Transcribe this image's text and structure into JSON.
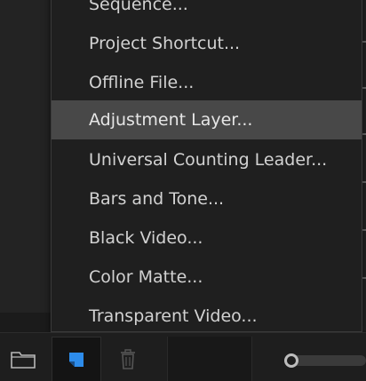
{
  "menu": {
    "items": [
      {
        "label": "Sequence...",
        "highlighted": false
      },
      {
        "label": "Project Shortcut...",
        "highlighted": false
      },
      {
        "label": "Offline File...",
        "highlighted": false
      },
      {
        "label": "Adjustment Layer...",
        "highlighted": true
      },
      {
        "label": "Universal Counting Leader...",
        "highlighted": false
      },
      {
        "label": "Bars and Tone...",
        "highlighted": false
      },
      {
        "label": "Black Video...",
        "highlighted": false
      },
      {
        "label": "Color Matte...",
        "highlighted": false
      },
      {
        "label": "Transparent Video...",
        "highlighted": false
      }
    ]
  },
  "toolbar": {
    "icons": [
      "folder-icon",
      "new-item-icon",
      "trash-icon"
    ]
  },
  "colors": {
    "menu_bg": "#1f1f1f",
    "highlight_bg": "#484848",
    "text": "#d2d2d2",
    "accent_blue": "#2d8ceb"
  }
}
